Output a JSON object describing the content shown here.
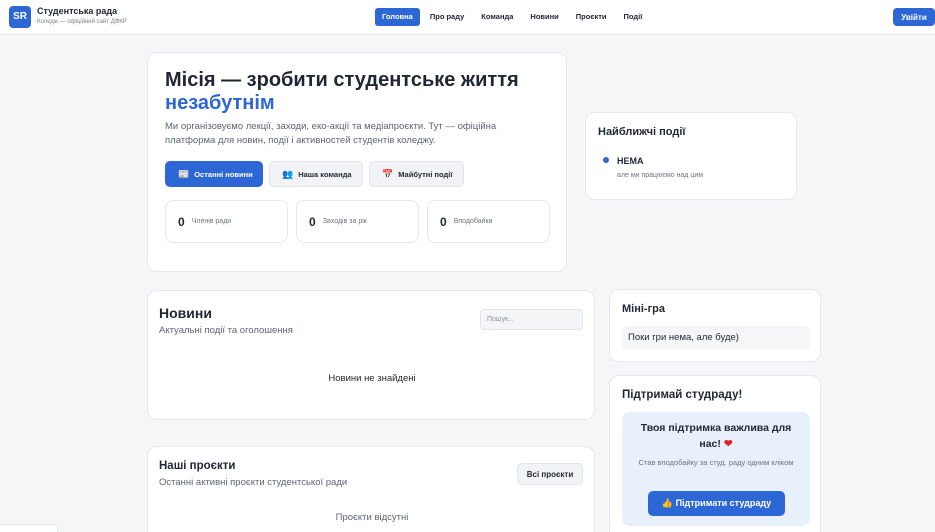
{
  "header": {
    "logo_text": "SR",
    "brand_title": "Студентська рада",
    "brand_subtitle": "Коледж — офіційний сайт ДФКР",
    "nav": [
      "Головна",
      "Про раду",
      "Команда",
      "Новини",
      "Проєкти",
      "Події"
    ],
    "active_nav": "Головна",
    "login_label": "Увійти"
  },
  "hero": {
    "title": "Місія — зробити студентське життя",
    "title_accent": "незабутнім",
    "description": "Ми організовуємо лекції, заходи, еко-акції та медіапроєкти. Тут — офіційна платформа для новин, події і активностей студентів коледжу.",
    "buttons": [
      {
        "label": "Останні новини",
        "icon": "📰"
      },
      {
        "label": "Наша команда",
        "icon": "👥"
      },
      {
        "label": "Майбутні події",
        "icon": "📅"
      }
    ],
    "stats": [
      {
        "value": "0",
        "label": "Членів ради"
      },
      {
        "value": "0",
        "label": "Заходів за рік"
      },
      {
        "value": "0",
        "label": "Вподобайки"
      }
    ]
  },
  "events": {
    "title": "Найближчі події",
    "item_title": "НЕМА",
    "item_subtitle": "але ми працюємо над цим"
  },
  "news": {
    "title": "Новини",
    "subtitle": "Актуальні події та оголошення",
    "search_placeholder": "Пошук...",
    "empty": "Новини не знайдені"
  },
  "projects": {
    "title": "Наші проєкти",
    "subtitle": "Останні активні проєкти студентської ради",
    "all_label": "Всі проєкти",
    "empty": "Проєкти відсутні"
  },
  "minigame": {
    "title": "Міні-гра",
    "text": "Поки гри нема, але буде)"
  },
  "support": {
    "title": "Підтримай студраду!",
    "headline": "Твоя підтримка важлива для нас!",
    "heart": "❤",
    "text": "Став вподобайку за студ. раду одним кліком",
    "button_icon": "👍",
    "button_label": "Підтримати студраду"
  },
  "colors": {
    "accent": "#2d67d6",
    "heart": "#e02424",
    "support_box": "#e8f0fc"
  }
}
